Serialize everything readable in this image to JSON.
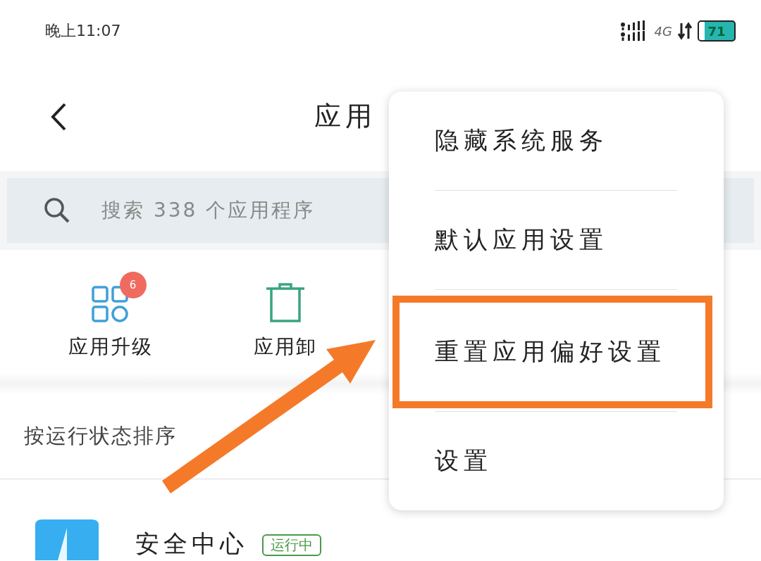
{
  "status_bar": {
    "time": "晚上11:07",
    "network": "4G",
    "battery": "71"
  },
  "header": {
    "title": "应用"
  },
  "search": {
    "placeholder": "搜索 338 个应用程序"
  },
  "quick_actions": [
    {
      "kind": "upgrade",
      "label": "应用升级",
      "badge": "6"
    },
    {
      "kind": "uninstall",
      "label": "应用卸"
    }
  ],
  "sort": {
    "label": "按运行状态排序"
  },
  "apps": [
    {
      "name": "安全中心",
      "status": "运行中"
    }
  ],
  "menu": {
    "items": [
      {
        "label": "隐藏系统服务",
        "highlighted": false
      },
      {
        "label": "默认应用设置",
        "highlighted": false
      },
      {
        "label": "重置应用偏好设置",
        "highlighted": true
      },
      {
        "label": "设置",
        "highlighted": false
      }
    ]
  }
}
